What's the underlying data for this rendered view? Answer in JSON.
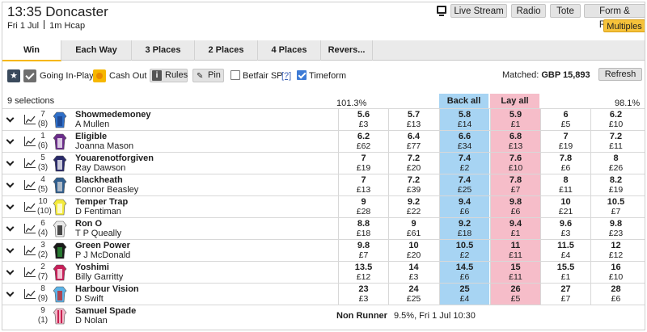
{
  "header": {
    "title": "13:35 Doncaster",
    "date": "Fri 1 Jul",
    "race_type": "1m Hcap",
    "buttons": [
      "Live Stream",
      "Radio",
      "Tote",
      "Form & Results"
    ],
    "multiples": "Multiples"
  },
  "tabs": [
    "Win",
    "Each Way",
    "3 Places",
    "2 Places",
    "4 Places",
    "Revers..."
  ],
  "toolbar": {
    "going_in_play": "Going In-Play",
    "cash_out": "Cash Out",
    "rules": "Rules",
    "pin": "Pin",
    "betfair_sp": "Betfair SP",
    "help": "[?]",
    "timeform": "Timeform",
    "matched_label": "Matched:",
    "matched_value": "GBP 15,893",
    "refresh": "Refresh"
  },
  "market": {
    "selections": "9 selections",
    "book_back": "101.3%",
    "book_lay": "98.1%",
    "back_all": "Back all",
    "lay_all": "Lay all"
  },
  "colors": {
    "back": "#a7d4f3",
    "lay": "#f6bdc9",
    "accent": "#f6b700"
  },
  "runners": [
    {
      "number": "7",
      "draw": "(8)",
      "name": "Showmedemoney",
      "jockey": "A Mullen",
      "prices": [
        [
          "5.6",
          "£3"
        ],
        [
          "5.7",
          "£13"
        ],
        [
          "5.8",
          "£14"
        ],
        [
          "5.9",
          "£1"
        ],
        [
          "6",
          "£5"
        ],
        [
          "6.2",
          "£10"
        ]
      ]
    },
    {
      "number": "1",
      "draw": "(6)",
      "name": "Eligible",
      "jockey": "Joanna Mason",
      "prices": [
        [
          "6.2",
          "£62"
        ],
        [
          "6.4",
          "£77"
        ],
        [
          "6.6",
          "£34"
        ],
        [
          "6.8",
          "£13"
        ],
        [
          "7",
          "£19"
        ],
        [
          "7.2",
          "£11"
        ]
      ]
    },
    {
      "number": "5",
      "draw": "(3)",
      "name": "Youarenotforgiven",
      "jockey": "Ray Dawson",
      "prices": [
        [
          "7",
          "£19"
        ],
        [
          "7.2",
          "£20"
        ],
        [
          "7.4",
          "£2"
        ],
        [
          "7.6",
          "£10"
        ],
        [
          "7.8",
          "£6"
        ],
        [
          "8",
          "£26"
        ]
      ]
    },
    {
      "number": "4",
      "draw": "(5)",
      "name": "Blackheath",
      "jockey": "Connor Beasley",
      "prices": [
        [
          "7",
          "£13"
        ],
        [
          "7.2",
          "£39"
        ],
        [
          "7.4",
          "£25"
        ],
        [
          "7.8",
          "£7"
        ],
        [
          "8",
          "£11"
        ],
        [
          "8.2",
          "£19"
        ]
      ]
    },
    {
      "number": "10",
      "draw": "(10)",
      "name": "Temper Trap",
      "jockey": "D Fentiman",
      "prices": [
        [
          "9",
          "£28"
        ],
        [
          "9.2",
          "£22"
        ],
        [
          "9.4",
          "£6"
        ],
        [
          "9.8",
          "£6"
        ],
        [
          "10",
          "£21"
        ],
        [
          "10.5",
          "£7"
        ]
      ]
    },
    {
      "number": "6",
      "draw": "(4)",
      "name": "Ron O",
      "jockey": "T P Queally",
      "prices": [
        [
          "8.8",
          "£18"
        ],
        [
          "9",
          "£61"
        ],
        [
          "9.2",
          "£18"
        ],
        [
          "9.4",
          "£1"
        ],
        [
          "9.6",
          "£3"
        ],
        [
          "9.8",
          "£23"
        ]
      ]
    },
    {
      "number": "3",
      "draw": "(2)",
      "name": "Green Power",
      "jockey": "P J McDonald",
      "prices": [
        [
          "9.8",
          "£7"
        ],
        [
          "10",
          "£20"
        ],
        [
          "10.5",
          "£2"
        ],
        [
          "11",
          "£11"
        ],
        [
          "11.5",
          "£4"
        ],
        [
          "12",
          "£12"
        ]
      ]
    },
    {
      "number": "2",
      "draw": "(7)",
      "name": "Yoshimi",
      "jockey": "Billy Garritty",
      "prices": [
        [
          "13.5",
          "£12"
        ],
        [
          "14",
          "£3"
        ],
        [
          "14.5",
          "£6"
        ],
        [
          "15",
          "£11"
        ],
        [
          "15.5",
          "£1"
        ],
        [
          "16",
          "£10"
        ]
      ]
    },
    {
      "number": "8",
      "draw": "(9)",
      "name": "Harbour Vision",
      "jockey": "D Swift",
      "prices": [
        [
          "23",
          "£3"
        ],
        [
          "24",
          "£25"
        ],
        [
          "25",
          "£4"
        ],
        [
          "26",
          "£5"
        ],
        [
          "27",
          "£7"
        ],
        [
          "28",
          "£6"
        ]
      ]
    }
  ],
  "non_runner": {
    "number": "9",
    "draw": "(1)",
    "name": "Samuel Spade",
    "jockey": "D Nolan",
    "label": "Non Runner",
    "info": "9.5%, Fri 1 Jul 10:30"
  },
  "icons": {
    "star": "star-icon",
    "tv": "tv-icon",
    "expand": "chevron-down-icon",
    "form": "chart-icon",
    "pin": "pin-icon",
    "info": "info-icon"
  }
}
